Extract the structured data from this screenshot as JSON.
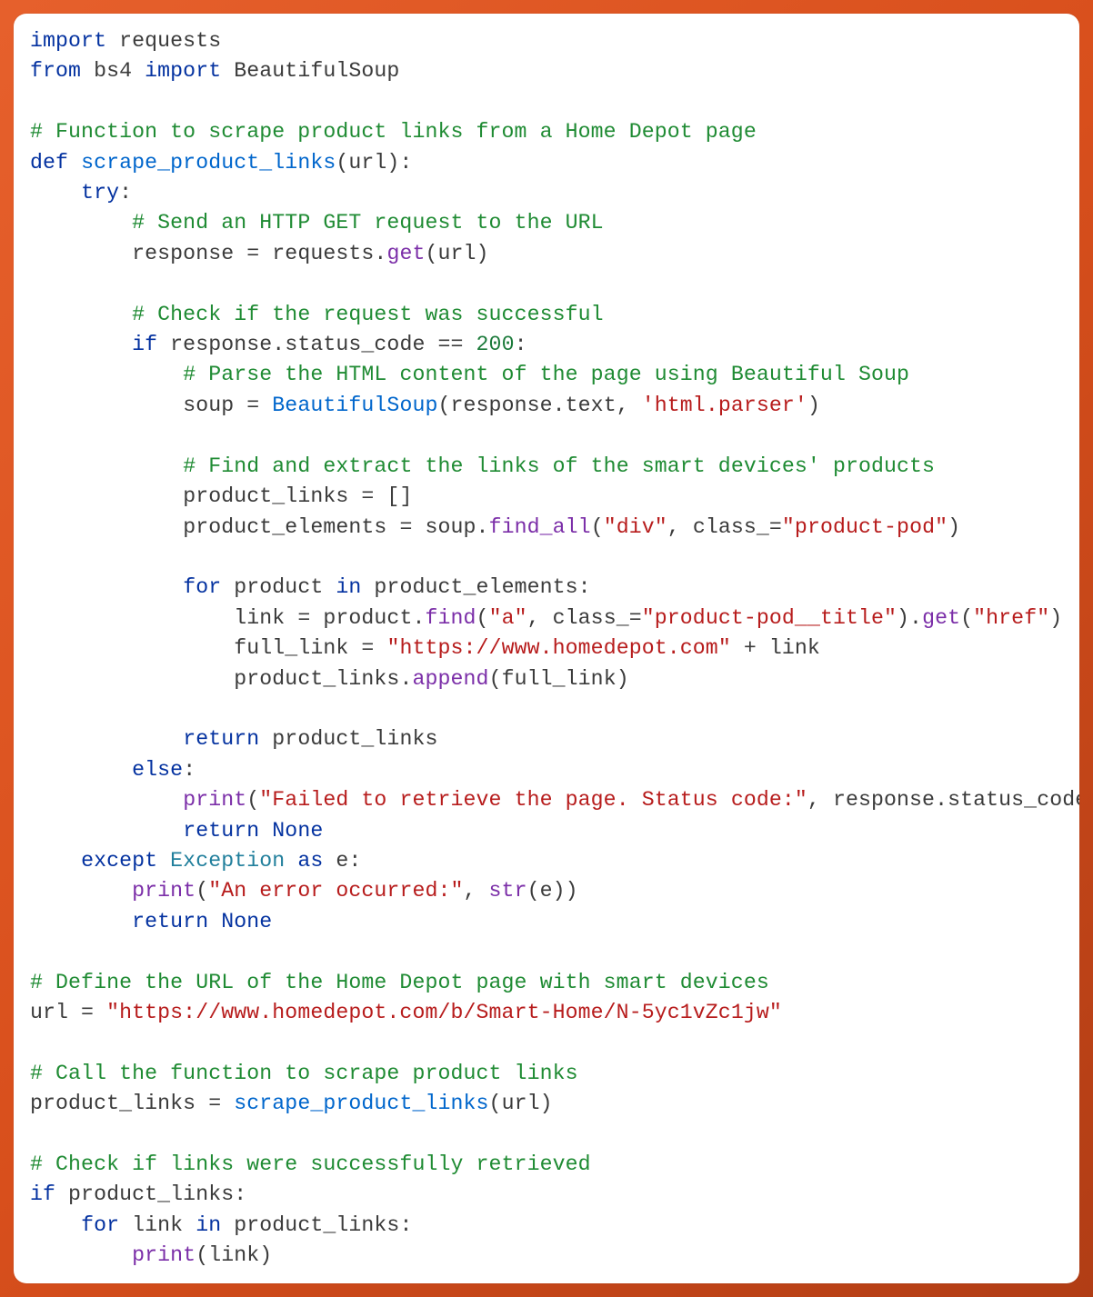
{
  "code": {
    "l1_import": "import",
    "l1_requests": "requests",
    "l2_from": "from",
    "l2_bs4": "bs4",
    "l2_import": "import",
    "l2_BeautifulSoup": "BeautifulSoup",
    "l4_comment": "# Function to scrape product links from a Home Depot page",
    "l5_def": "def",
    "l5_fn": "scrape_product_links",
    "l5_param": "url",
    "l6_try": "try",
    "l7_comment": "# Send an HTTP GET request to the URL",
    "l8_response": "response",
    "l8_requests": "requests",
    "l8_get": "get",
    "l8_url": "url",
    "l10_comment": "# Check if the request was successful",
    "l11_if": "if",
    "l11_response": "response",
    "l11_status_code": "status_code",
    "l11_eq": "==",
    "l11_200": "200",
    "l12_comment": "# Parse the HTML content of the page using Beautiful Soup",
    "l13_soup": "soup",
    "l13_BeautifulSoup": "BeautifulSoup",
    "l13_response": "response",
    "l13_text": "text",
    "l13_htmlparser": "'html.parser'",
    "l15_comment": "# Find and extract the links of the smart devices' products",
    "l16_product_links": "product_links",
    "l17_product_elements": "product_elements",
    "l17_soup": "soup",
    "l17_find_all": "find_all",
    "l17_div": "\"div\"",
    "l17_class_kw": "class_",
    "l17_class_val": "\"product-pod\"",
    "l19_for": "for",
    "l19_product": "product",
    "l19_in": "in",
    "l19_product_elements": "product_elements",
    "l20_link": "link",
    "l20_product": "product",
    "l20_find": "find",
    "l20_a": "\"a\"",
    "l20_class_kw": "class_",
    "l20_class_val": "\"product-pod__title\"",
    "l20_get": "get",
    "l20_href": "\"href\"",
    "l21_full_link": "full_link",
    "l21_url_str": "\"https://www.homedepot.com\"",
    "l21_link": "link",
    "l22_product_links": "product_links",
    "l22_append": "append",
    "l22_full_link": "full_link",
    "l24_return": "return",
    "l24_product_links": "product_links",
    "l25_else": "else",
    "l26_print": "print",
    "l26_msg": "\"Failed to retrieve the page. Status code:\"",
    "l26_response": "response",
    "l26_status_code": "status_code",
    "l27_return": "return",
    "l27_none": "None",
    "l28_except": "except",
    "l28_exception": "Exception",
    "l28_as": "as",
    "l28_e": "e",
    "l29_print": "print",
    "l29_msg": "\"An error occurred:\"",
    "l29_str": "str",
    "l29_e": "e",
    "l30_return": "return",
    "l30_none": "None",
    "l32_comment": "# Define the URL of the Home Depot page with smart devices",
    "l33_url": "url",
    "l33_val": "\"https://www.homedepot.com/b/Smart-Home/N-5yc1vZc1jw\"",
    "l35_comment": "# Call the function to scrape product links",
    "l36_product_links": "product_links",
    "l36_fn": "scrape_product_links",
    "l36_url": "url",
    "l38_comment": "# Check if links were successfully retrieved",
    "l39_if": "if",
    "l39_product_links": "product_links",
    "l40_for": "for",
    "l40_link": "link",
    "l40_in": "in",
    "l40_product_links": "product_links",
    "l41_print": "print",
    "l41_link": "link"
  }
}
